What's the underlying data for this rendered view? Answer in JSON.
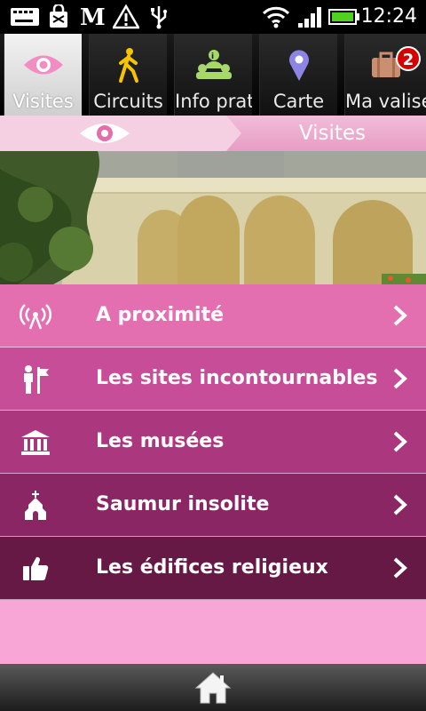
{
  "status_bar": {
    "time": "12:24",
    "icons": [
      "keyboard-icon",
      "shopping-bag-icon",
      "newspaper-icon",
      "warning-icon",
      "usb-icon",
      "wifi-icon",
      "signal-icon",
      "battery-icon"
    ]
  },
  "tabs": [
    {
      "label": "Visites",
      "icon": "eye-icon",
      "active": true
    },
    {
      "label": "Circuits",
      "icon": "walker-icon"
    },
    {
      "label": "Info prati",
      "icon": "info-people-icon"
    },
    {
      "label": "Carte",
      "icon": "map-pin-icon"
    },
    {
      "label": "Ma valise",
      "icon": "suitcase-icon",
      "badge": "2"
    }
  ],
  "section": {
    "title": "Visites",
    "icon": "eye-icon"
  },
  "banner": {
    "description_icon": "photo-bridge"
  },
  "menu": {
    "items": [
      {
        "label": "A proximité",
        "icon": "radar-icon",
        "bg": "#e46fb0"
      },
      {
        "label": "Les sites incontournables",
        "icon": "signpost-icon",
        "bg": "#c84d98"
      },
      {
        "label": "Les musées",
        "icon": "museum-icon",
        "bg": "#ab387f"
      },
      {
        "label": "Saumur insolite",
        "icon": "chapel-icon",
        "bg": "#8b2664"
      },
      {
        "label": "Les édifices religieux",
        "icon": "thumbs-up-icon",
        "bg": "#661945"
      }
    ]
  },
  "bottom": {
    "home_icon": "home-icon"
  },
  "colors": {
    "accent": "#e46fb0",
    "background": "#f7a6d6"
  }
}
